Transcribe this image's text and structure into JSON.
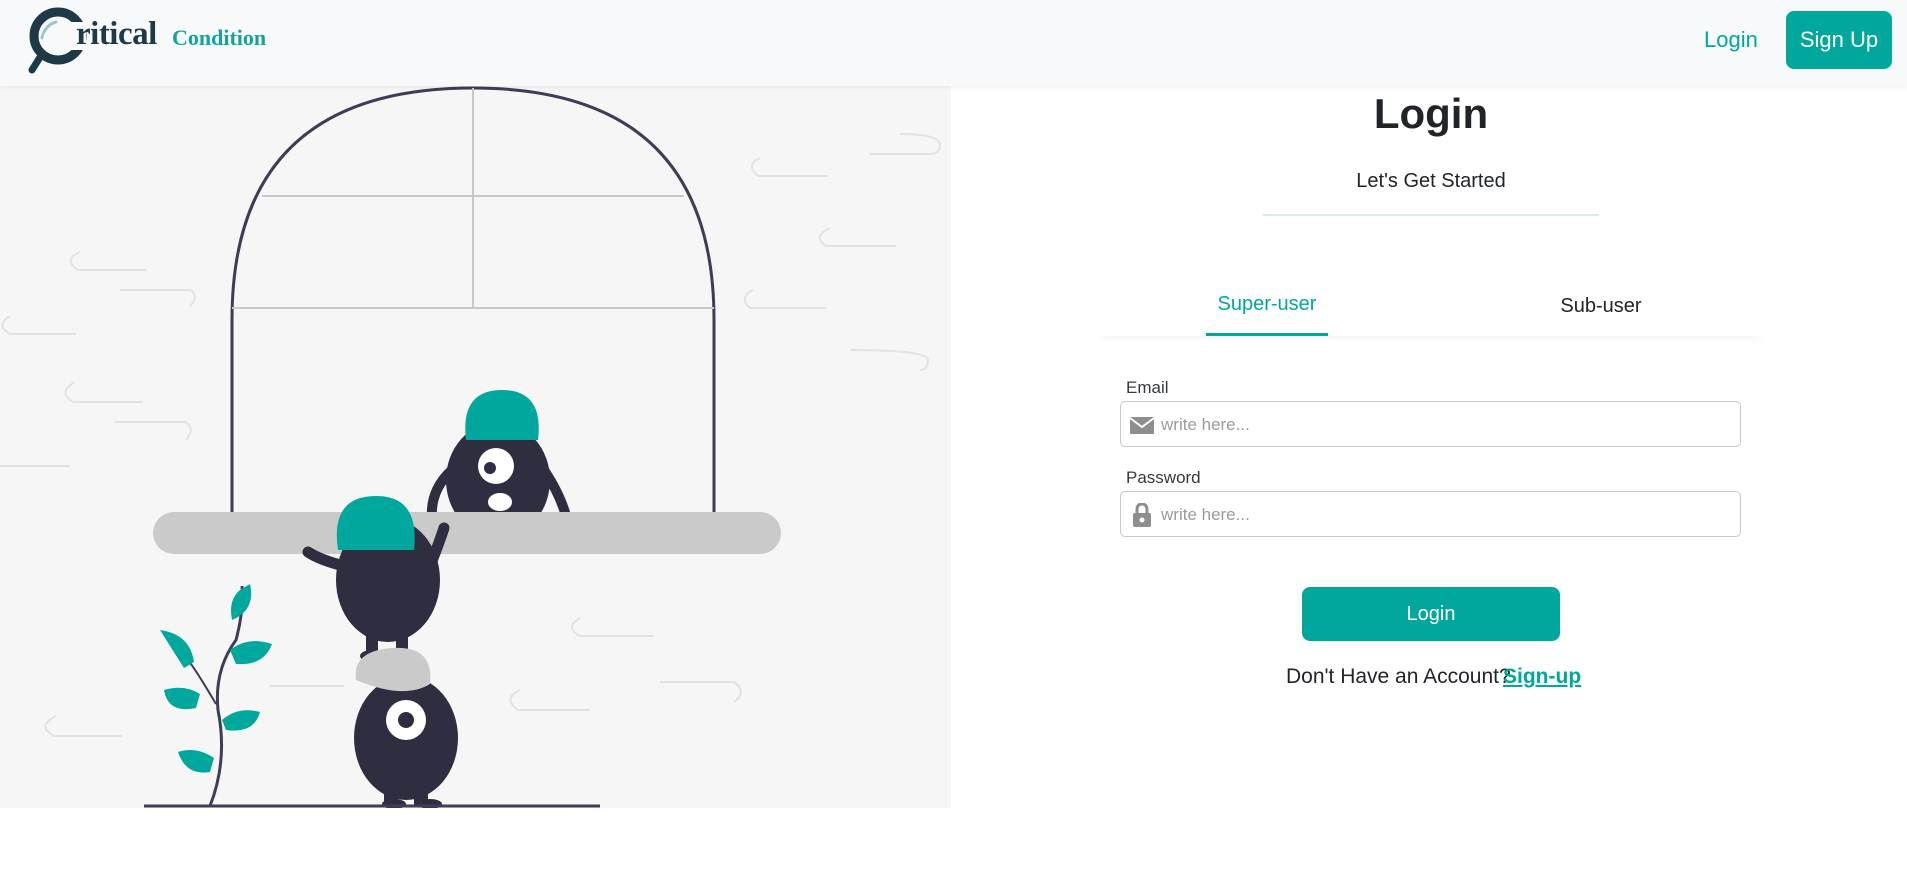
{
  "brand": {
    "name_part1": "ritical",
    "name_part2": "Condition",
    "primary_color": "#00a79d",
    "dark_color": "#1e3a47"
  },
  "nav": {
    "login_label": "Login",
    "signup_label": "Sign Up"
  },
  "form": {
    "title": "Login",
    "subtitle": "Let's Get Started",
    "tabs": [
      {
        "label": "Super-user",
        "active": true
      },
      {
        "label": "Sub-user",
        "active": false
      }
    ],
    "email": {
      "label": "Email",
      "placeholder": "write here...",
      "value": "",
      "icon": "envelope-icon"
    },
    "password": {
      "label": "Password",
      "placeholder": "write here...",
      "value": "",
      "icon": "lock-icon"
    },
    "submit_label": "Login",
    "signup_prompt": "Don't Have an Account?",
    "signup_link": "Sign-up"
  }
}
